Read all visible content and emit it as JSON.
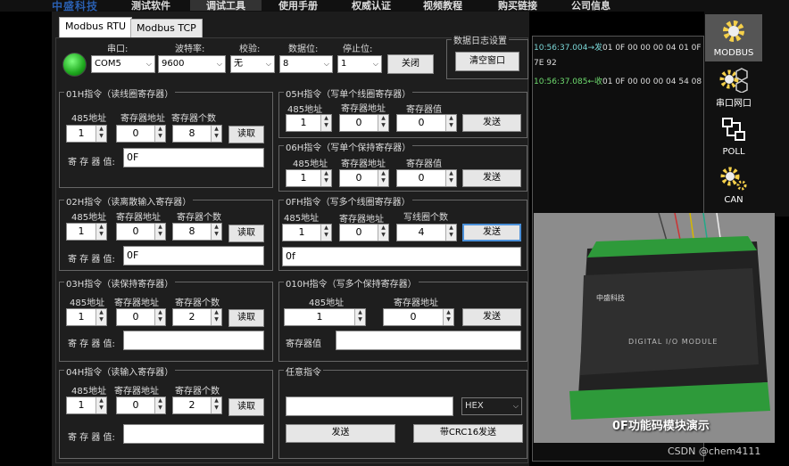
{
  "topbar": {
    "logo": "中盛科技",
    "menu": [
      "测试软件",
      "调试工具",
      "使用手册",
      "权威认证",
      "视频教程",
      "购买链接",
      "公司信息"
    ],
    "active_index": 1
  },
  "tabs": [
    "Modbus RTU",
    "Modbus TCP"
  ],
  "serial": {
    "port_label": "串口:",
    "port_value": "COM5",
    "baud_label": "波特率:",
    "baud_value": "9600",
    "parity_label": "校验:",
    "parity_value": "无",
    "databits_label": "数据位:",
    "databits_value": "8",
    "stopbits_label": "停止位:",
    "stopbits_value": "1",
    "close_button": "关闭",
    "status_color": "#2ecc2e"
  },
  "log_settings": {
    "title": "数据日志设置",
    "clear_button": "清空窗口"
  },
  "f01": {
    "title": "01H指令（读线圈寄存器）",
    "addr_label": "485地址",
    "reg_label": "寄存器地址",
    "count_label": "寄存器个数",
    "addr": "1",
    "reg": "0",
    "count": "8",
    "read_button": "读取",
    "value_label": "寄 存 器 值:",
    "value": "0F"
  },
  "f02": {
    "title": "02H指令（读离散输入寄存器）",
    "addr_label": "485地址",
    "reg_label": "寄存器地址",
    "count_label": "寄存器个数",
    "addr": "1",
    "reg": "0",
    "count": "8",
    "read_button": "读取",
    "value_label": "寄 存 器 值:",
    "value": "0F"
  },
  "f03": {
    "title": "03H指令（读保持寄存器）",
    "addr_label": "485地址",
    "reg_label": "寄存器地址",
    "count_label": "寄存器个数",
    "addr": "1",
    "reg": "0",
    "count": "2",
    "read_button": "读取",
    "value_label": "寄 存 器 值:",
    "value": ""
  },
  "f04": {
    "title": "04H指令（读输入寄存器）",
    "addr_label": "485地址",
    "reg_label": "寄存器地址",
    "count_label": "寄存器个数",
    "addr": "1",
    "reg": "0",
    "count": "2",
    "read_button": "读取",
    "value_label": "寄 存 器 值:",
    "value": ""
  },
  "f05": {
    "title": "05H指令（写单个线圈寄存器）",
    "addr_label": "485地址",
    "reg_label": "寄存器地址",
    "val_label": "寄存器值",
    "addr": "1",
    "reg": "0",
    "val": "0",
    "send_button": "发送"
  },
  "f06": {
    "title": "06H指令（写单个保持寄存器）",
    "addr_label": "485地址",
    "reg_label": "寄存器地址",
    "val_label": "寄存器值",
    "addr": "1",
    "reg": "0",
    "val": "0",
    "send_button": "发送"
  },
  "f0f": {
    "title": "0FH指令（写多个线圈寄存器）",
    "addr_label": "485地址",
    "reg_label": "寄存器地址",
    "count_label": "写线圈个数",
    "addr": "1",
    "reg": "0",
    "count": "4",
    "send_button": "发送",
    "data": "0f"
  },
  "f10": {
    "title": "010H指令（写多个保持寄存器）",
    "addr_label": "485地址",
    "reg_label": "寄存器地址",
    "addr": "1",
    "reg": "0",
    "send_button": "发送",
    "value_label": "寄存器值",
    "value": ""
  },
  "custom": {
    "title": "任意指令",
    "input": "",
    "format": "HEX",
    "send_button": "发送",
    "crc_button": "带CRC16发送"
  },
  "log": {
    "line1_time": "10:56:37.004→发",
    "line1_data": "01 0F 00 00 00 04 01 0F",
    "line1_cont": "7E 92",
    "line2_time": "10:56:37.085←收",
    "line2_data": "01 0F 00 00 00 04 54 08"
  },
  "nav": [
    {
      "label": "MODBUS",
      "icon": "gear-icon"
    },
    {
      "label": "串口网口",
      "icon": "network-icon"
    },
    {
      "label": "POLL",
      "icon": "poll-icon"
    },
    {
      "label": "CAN",
      "icon": "can-icon"
    }
  ],
  "photo": {
    "brand": "中盛科技",
    "module_label": "DIGITAL I/O MODULE",
    "caption": "0F功能码模块演示"
  },
  "footer": "CSDN @chem4111"
}
